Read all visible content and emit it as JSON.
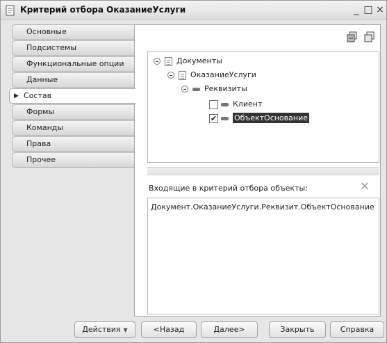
{
  "window": {
    "title": "Критерий отбора ОказаниеУслуги",
    "minimize_label": "_",
    "maximize_label": "□",
    "close_label": "×"
  },
  "nav": {
    "items": [
      {
        "label": "Основные"
      },
      {
        "label": "Подсистемы"
      },
      {
        "label": "Функциональные опции"
      },
      {
        "label": "Данные"
      },
      {
        "label": "Состав"
      },
      {
        "label": "Формы"
      },
      {
        "label": "Команды"
      },
      {
        "label": "Права"
      },
      {
        "label": "Прочее"
      }
    ],
    "active_index": 4
  },
  "tree": {
    "root": "Документы",
    "document": "ОказаниеУслуги",
    "group": "Реквизиты",
    "attributes": [
      {
        "label": "Клиент",
        "checked": false,
        "mark": ""
      },
      {
        "label": "ОбъектОснование",
        "checked": true,
        "mark": "✔"
      }
    ]
  },
  "list": {
    "label": "Входящие в критерий отбора объекты:",
    "items": [
      "Документ.ОказаниеУслуги.Реквизит.ОбъектОснование"
    ]
  },
  "buttons": {
    "actions": "Действия",
    "back": "<Назад",
    "next": "Далее>",
    "close": "Закрыть",
    "help": "Справка"
  },
  "icons": {
    "app": "form-icon",
    "toolbar": [
      "check-all-icon",
      "uncheck-all-icon"
    ],
    "clear": "clear-icon"
  }
}
